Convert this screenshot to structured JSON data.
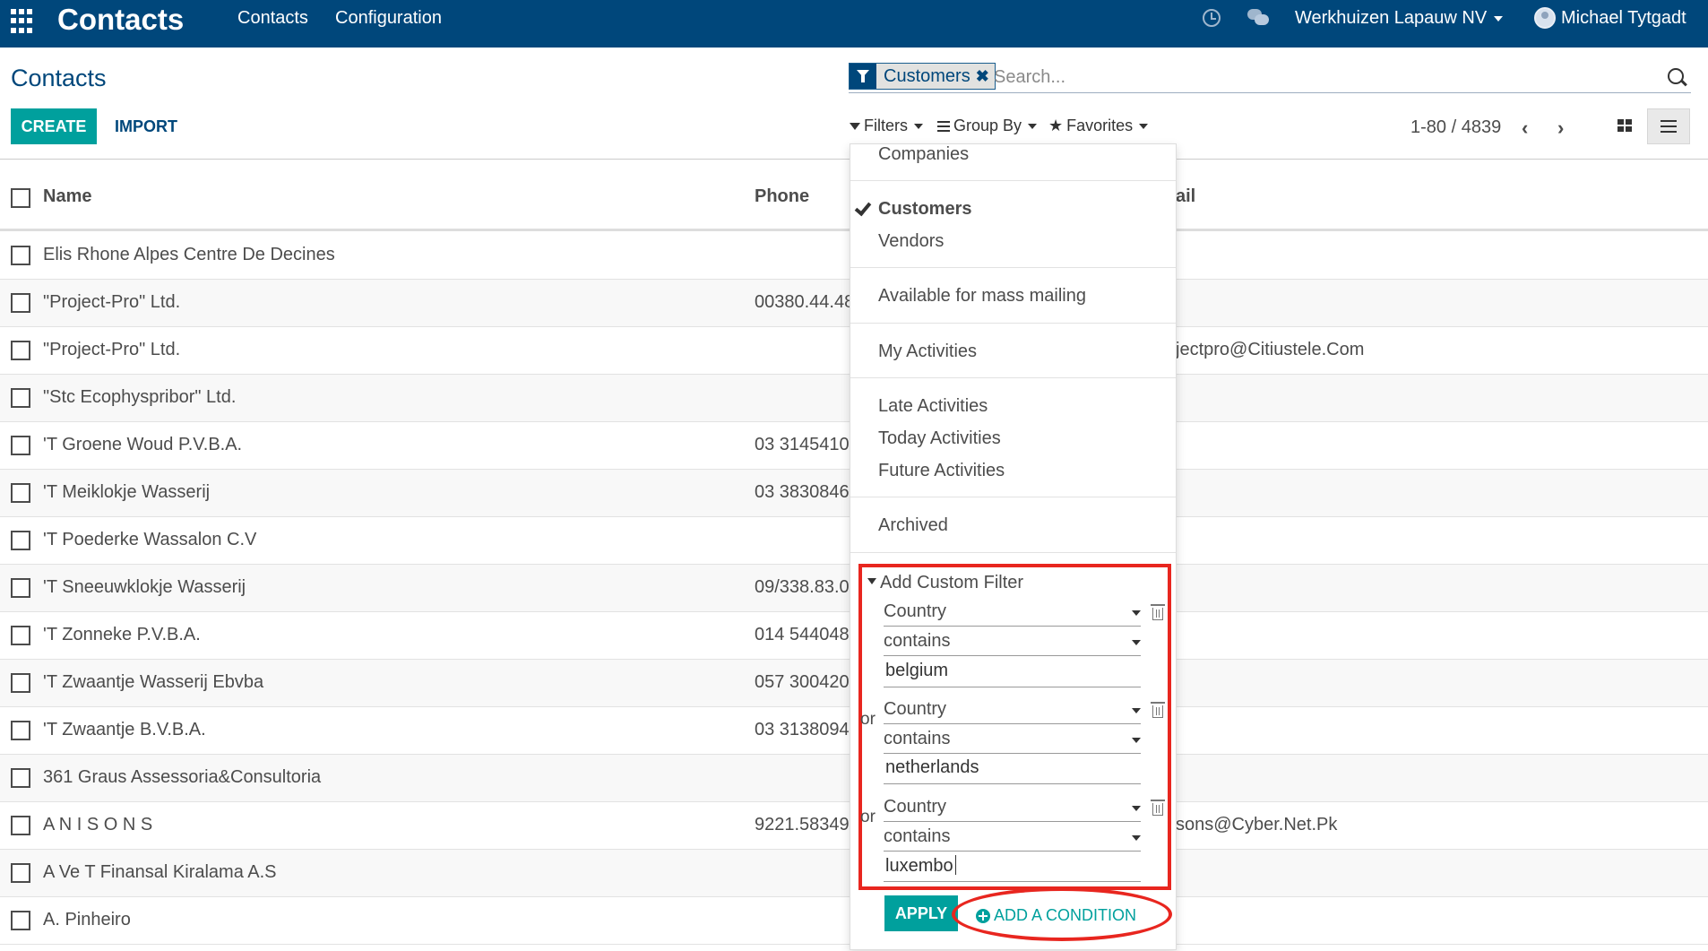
{
  "navbar": {
    "brand": "Contacts",
    "menu": [
      "Contacts",
      "Configuration"
    ],
    "company": "Werkhuizen Lapauw NV",
    "user": "Michael Tytgadt"
  },
  "control": {
    "title": "Contacts",
    "create_label": "CREATE",
    "import_label": "IMPORT",
    "facet_label": "Customers",
    "search_placeholder": "Search...",
    "filters_label": "Filters",
    "groupby_label": "Group By",
    "favorites_label": "Favorites",
    "pager": "1-80 / 4839"
  },
  "table": {
    "headers": {
      "name": "Name",
      "phone": "Phone",
      "email": "ail"
    },
    "rows": [
      {
        "name": "Elis Rhone Alpes Centre De Decines",
        "phone": "",
        "email": ""
      },
      {
        "name": "\"Project-Pro\" Ltd.",
        "phone": "00380.44.48",
        "email": ""
      },
      {
        "name": "\"Project-Pro\" Ltd.",
        "phone": "",
        "email": "jectpro@Citiustele.Com"
      },
      {
        "name": "\"Stc Ecophyspribor\" Ltd.",
        "phone": "",
        "email": ""
      },
      {
        "name": "'T Groene Woud P.V.B.A.",
        "phone": "03 3145410",
        "email": ""
      },
      {
        "name": "'T Meiklokje Wasserij",
        "phone": "03 3830846",
        "email": ""
      },
      {
        "name": "'T Poederke Wassalon C.V",
        "phone": "",
        "email": ""
      },
      {
        "name": "'T Sneeuwklokje Wasserij",
        "phone": "09/338.83.0",
        "email": ""
      },
      {
        "name": "'T Zonneke P.V.B.A.",
        "phone": "014 544048",
        "email": ""
      },
      {
        "name": "'T Zwaantje Wasserij Ebvba",
        "phone": "057 300420",
        "email": ""
      },
      {
        "name": "'T Zwaantje B.V.B.A.",
        "phone": "03 3138094",
        "email": ""
      },
      {
        "name": "361 Graus Assessoria&Consultoria",
        "phone": "",
        "email": ""
      },
      {
        "name": "A N I S O N S",
        "phone": "9221.58349",
        "email": "sons@Cyber.Net.Pk"
      },
      {
        "name": "A Ve T Finansal Kiralama A.S",
        "phone": "",
        "email": ""
      },
      {
        "name": "A. Pinheiro",
        "phone": "",
        "email": ""
      }
    ]
  },
  "filters": {
    "companies": "Companies",
    "customers": "Customers",
    "vendors": "Vendors",
    "mass_mailing": "Available for mass mailing",
    "my_activities": "My Activities",
    "late_activities": "Late Activities",
    "today_activities": "Today Activities",
    "future_activities": "Future Activities",
    "archived": "Archived",
    "custom_title": "Add Custom Filter",
    "or_label": "or",
    "conditions": [
      {
        "field": "Country",
        "operator": "contains",
        "value": "belgium"
      },
      {
        "field": "Country",
        "operator": "contains",
        "value": "netherlands"
      },
      {
        "field": "Country",
        "operator": "contains",
        "value": "luxembo"
      }
    ],
    "apply_label": "APPLY",
    "add_condition_label": "ADD A CONDITION"
  },
  "colors": {
    "navbar": "#00477b",
    "accent": "#00a09d",
    "highlight": "#e8261f"
  }
}
